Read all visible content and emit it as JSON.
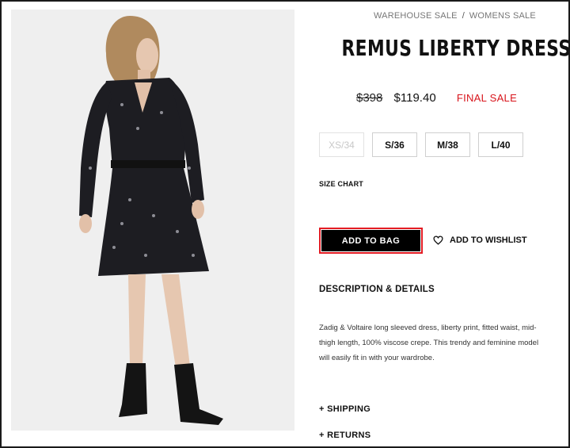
{
  "breadcrumb": {
    "items": [
      "WAREHOUSE SALE",
      "WOMENS SALE"
    ],
    "separator": "/"
  },
  "product": {
    "title": "REMUS LIBERTY DRESS",
    "original_price": "$398",
    "sale_price": "$119.40",
    "sale_badge": "FINAL SALE",
    "sale_badge_color": "#d8141b",
    "sizes": [
      {
        "label": "XS/34",
        "available": false
      },
      {
        "label": "S/36",
        "available": true
      },
      {
        "label": "M/38",
        "available": true
      },
      {
        "label": "L/40",
        "available": true
      }
    ],
    "size_chart_label": "SIZE CHART",
    "add_to_bag_label": "ADD TO BAG",
    "wishlist_label": "ADD TO WISHLIST",
    "wishlist_icon": "heart-icon",
    "description_heading": "DESCRIPTION & DETAILS",
    "description": "Zadig & Voltaire long sleeved dress, liberty print, fitted waist, mid-thigh length, 100% viscose crepe. This trendy and feminine model will easily fit in with your wardrobe.",
    "accordions": [
      "+ SHIPPING",
      "+ RETURNS"
    ]
  }
}
